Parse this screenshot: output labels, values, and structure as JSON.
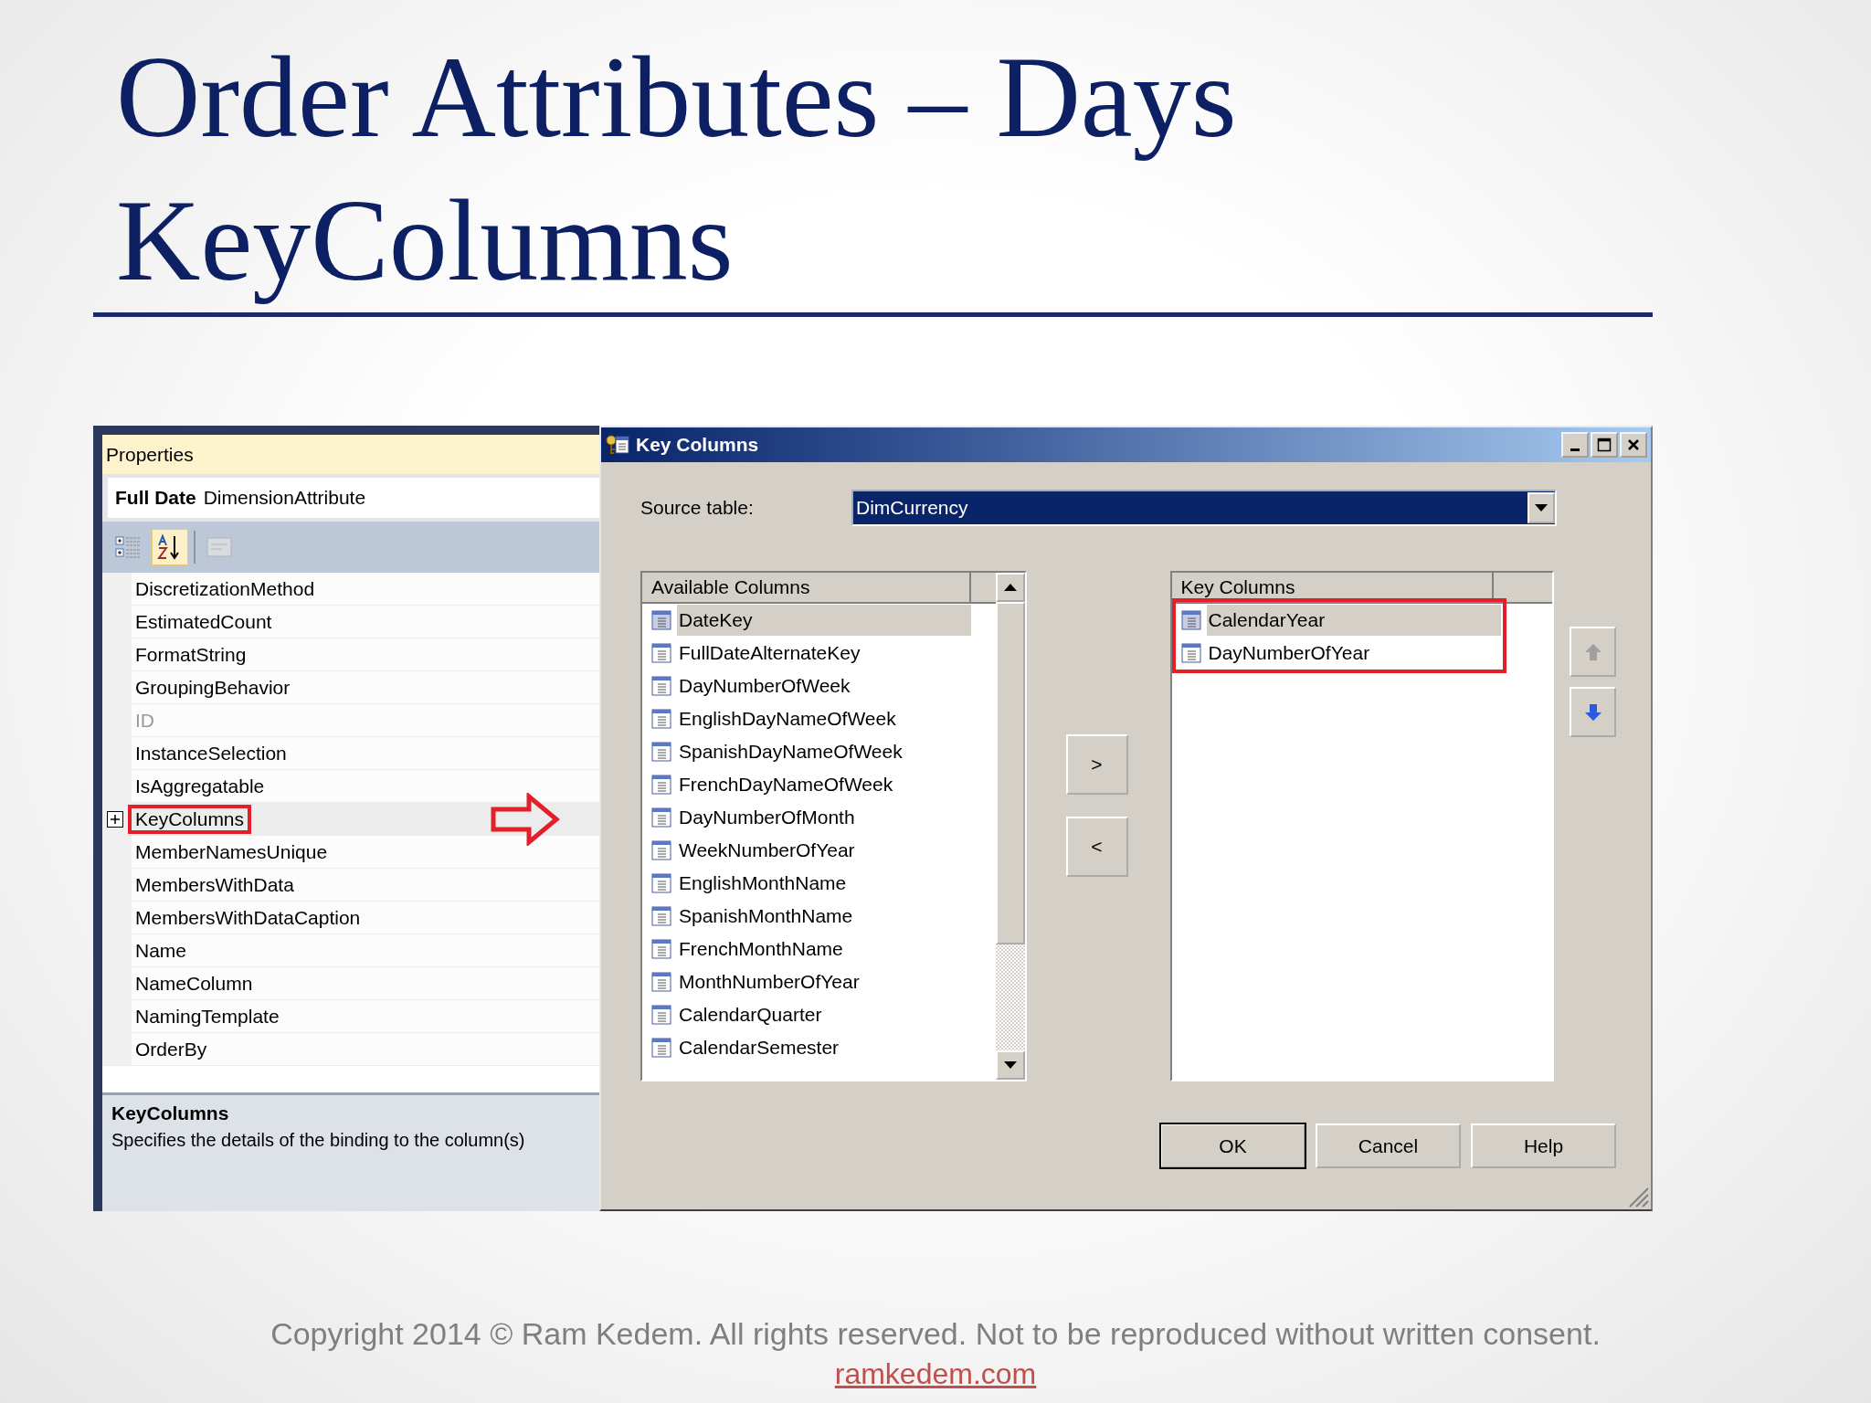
{
  "slide": {
    "title": "Order Attributes – Days KeyColumns",
    "copyright": "Copyright 2014 © Ram Kedem. All rights reserved. Not to be reproduced without written consent.",
    "link": "ramkedem.com"
  },
  "properties": {
    "title": "Properties",
    "object_name": "Full Date",
    "object_type": "DimensionAttribute",
    "toolbar": [
      {
        "kind": "categorized",
        "selected": false,
        "disabled": false
      },
      {
        "kind": "alphabetical",
        "selected": true,
        "disabled": false
      },
      {
        "kind": "property_pages",
        "selected": false,
        "disabled": true
      }
    ],
    "items": [
      {
        "name": "DiscretizationMethod",
        "selected": false,
        "disabled": false,
        "expandable": false,
        "outlined": false
      },
      {
        "name": "EstimatedCount",
        "selected": false,
        "disabled": false,
        "expandable": false,
        "outlined": false
      },
      {
        "name": "FormatString",
        "selected": false,
        "disabled": false,
        "expandable": false,
        "outlined": false
      },
      {
        "name": "GroupingBehavior",
        "selected": false,
        "disabled": false,
        "expandable": false,
        "outlined": false
      },
      {
        "name": "ID",
        "selected": false,
        "disabled": true,
        "expandable": false,
        "outlined": false
      },
      {
        "name": "InstanceSelection",
        "selected": false,
        "disabled": false,
        "expandable": false,
        "outlined": false
      },
      {
        "name": "IsAggregatable",
        "selected": false,
        "disabled": false,
        "expandable": false,
        "outlined": false
      },
      {
        "name": "KeyColumns",
        "selected": true,
        "disabled": false,
        "expandable": true,
        "outlined": true
      },
      {
        "name": "MemberNamesUnique",
        "selected": false,
        "disabled": false,
        "expandable": false,
        "outlined": false
      },
      {
        "name": "MembersWithData",
        "selected": false,
        "disabled": false,
        "expandable": false,
        "outlined": false
      },
      {
        "name": "MembersWithDataCaption",
        "selected": false,
        "disabled": false,
        "expandable": false,
        "outlined": false
      },
      {
        "name": "Name",
        "selected": false,
        "disabled": false,
        "expandable": false,
        "outlined": false
      },
      {
        "name": "NameColumn",
        "selected": false,
        "disabled": false,
        "expandable": false,
        "outlined": false
      },
      {
        "name": "NamingTemplate",
        "selected": false,
        "disabled": false,
        "expandable": false,
        "outlined": false
      },
      {
        "name": "OrderBy",
        "selected": false,
        "disabled": false,
        "expandable": false,
        "outlined": false
      }
    ],
    "description": {
      "title": "KeyColumns",
      "text": "Specifies the details of the binding to the column(s)"
    }
  },
  "dialog": {
    "title": "Key Columns",
    "source_label": "Source table:",
    "source_value": "DimCurrency",
    "available": {
      "header": "Available Columns",
      "items": [
        {
          "name": "DateKey",
          "selected": true
        },
        {
          "name": "FullDateAlternateKey",
          "selected": false
        },
        {
          "name": "DayNumberOfWeek",
          "selected": false
        },
        {
          "name": "EnglishDayNameOfWeek",
          "selected": false
        },
        {
          "name": "SpanishDayNameOfWeek",
          "selected": false
        },
        {
          "name": "FrenchDayNameOfWeek",
          "selected": false
        },
        {
          "name": "DayNumberOfMonth",
          "selected": false
        },
        {
          "name": "WeekNumberOfYear",
          "selected": false
        },
        {
          "name": "EnglishMonthName",
          "selected": false
        },
        {
          "name": "SpanishMonthName",
          "selected": false
        },
        {
          "name": "FrenchMonthName",
          "selected": false
        },
        {
          "name": "MonthNumberOfYear",
          "selected": false
        },
        {
          "name": "CalendarQuarter",
          "selected": false
        },
        {
          "name": "CalendarSemester",
          "selected": false
        }
      ]
    },
    "transfer_buttons": [
      ">",
      "<"
    ],
    "key_columns": {
      "header": "Key Columns",
      "outlined": true,
      "items": [
        {
          "name": "CalendarYear",
          "selected": true
        },
        {
          "name": "DayNumberOfYear",
          "selected": false
        }
      ]
    },
    "move_buttons": [
      {
        "kind": "up",
        "disabled": true
      },
      {
        "kind": "down",
        "disabled": false
      }
    ],
    "buttons": [
      {
        "label": "OK",
        "default": true
      },
      {
        "label": "Cancel",
        "default": false
      },
      {
        "label": "Help",
        "default": false
      }
    ]
  }
}
